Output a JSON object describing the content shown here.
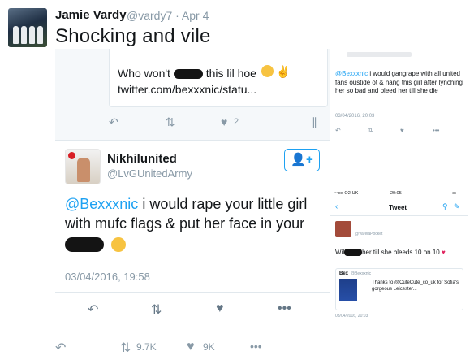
{
  "outer_tweet": {
    "name": "Jamie Vardy",
    "handle": "@vardy7 · Apr 4",
    "text": "Shocking and vile",
    "retweets": "9.7K",
    "likes": "9K"
  },
  "quoted_tweet": {
    "line1_pre": "Who won't",
    "line1_post": "this lil hoe",
    "line2": "twitter.com/bexxxnic/statu...",
    "likes": "2"
  },
  "reply_tweet": {
    "name": "Nikhilunited",
    "handle": "@LvGUnitedArmy",
    "mention": "@Bexxxnic",
    "line1_rest": " i would rape your little girl",
    "line2": "with mufc flags & put her face in your",
    "date": "03/04/2016, 19:58",
    "follow_icon": "add-user-icon"
  },
  "screenshot_b": {
    "mention": "@Bexxxnic",
    "text_rest": " i would gangrape with all united fans oustide ot & hang this girl after lynching her so bad and bleed her till she die",
    "date": "03/04/2016, 20:03"
  },
  "screenshot_c": {
    "status_carrier": "•••oo O2-UK",
    "status_time": "20:05",
    "nav_title": "Tweet",
    "handle": "@VarelaPocket",
    "line_pre": "Wil",
    "line_post": "her till she bleeds 10 on 10",
    "card_name": "Bex",
    "card_handle": "@Bexxxnic",
    "card_text": "Thanks to @CuteCute_co_uk for Sofia's gorgeous Leicester...",
    "date": "03/04/2016, 20:03"
  },
  "colors": {
    "twitter_blue": "#1da1f2",
    "muted_gray": "#8899a6",
    "redaction": "#141414"
  }
}
